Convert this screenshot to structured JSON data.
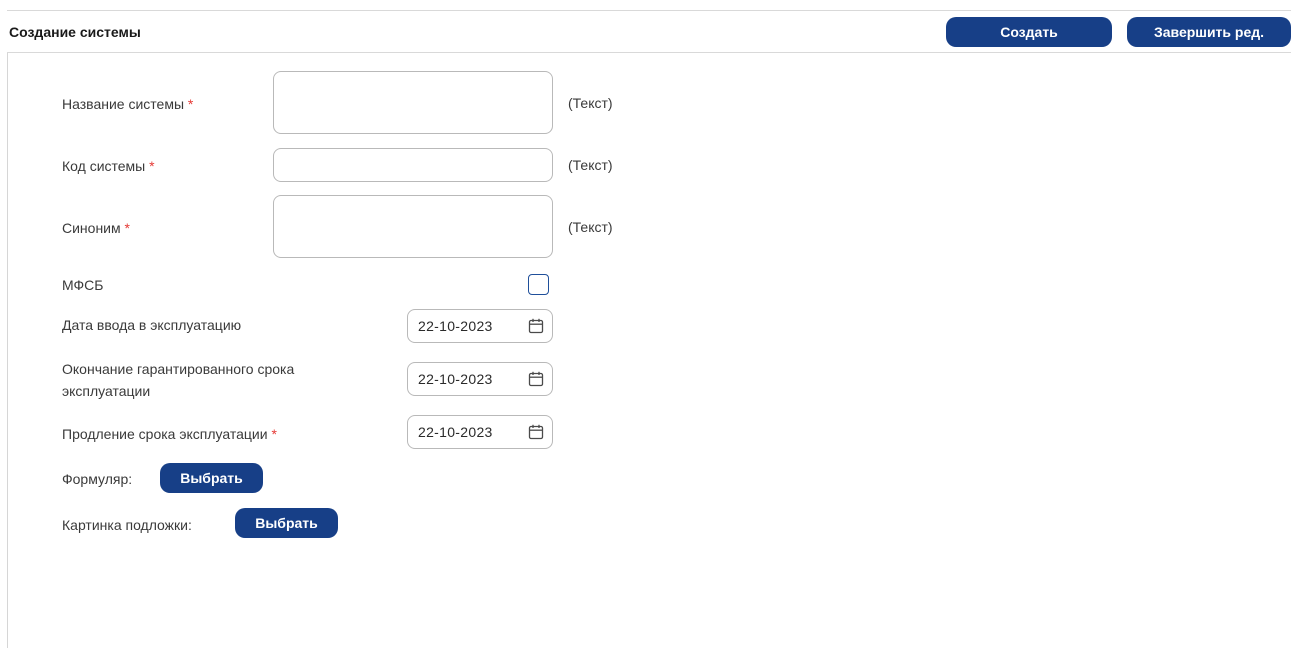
{
  "header": {
    "title": "Создание системы",
    "create_label": "Создать",
    "finish_label": "Завершить ред."
  },
  "form": {
    "system_name": {
      "label": "Название системы",
      "required_mark": "*",
      "value": "",
      "hint": "(Текст)"
    },
    "system_code": {
      "label": "Код системы",
      "required_mark": "*",
      "value": "",
      "hint": "(Текст)"
    },
    "synonym": {
      "label": "Синоним",
      "required_mark": "*",
      "value": "",
      "hint": "(Текст)"
    },
    "mfsb": {
      "label": "МФСБ",
      "checked": false
    },
    "commission_date": {
      "label": "Дата ввода в эксплуатацию",
      "value": "22-10-2023"
    },
    "warranty_end": {
      "label_line1": "Окончание гарантированного срока",
      "label_line2": "эксплуатации",
      "value": "22-10-2023"
    },
    "extension": {
      "label": "Продление срока эксплуатации",
      "required_mark": "*",
      "value": "22-10-2023"
    },
    "formular": {
      "label": "Формуляр:",
      "button_label": "Выбрать"
    },
    "background_image": {
      "label": "Картинка подложки:",
      "button_label": "Выбрать"
    }
  },
  "colors": {
    "primary_button": "#173f87",
    "required_mark": "#e53935",
    "checkbox_border": "#1f4f9a"
  },
  "icons": {
    "date_picker": "calendar-icon"
  }
}
